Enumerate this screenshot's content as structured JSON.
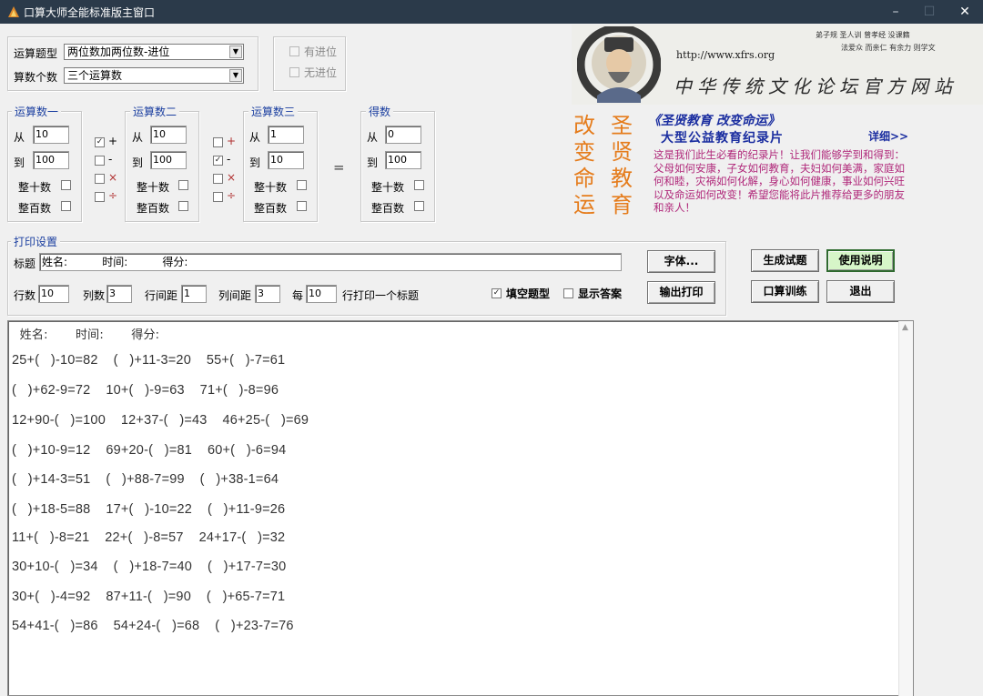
{
  "window": {
    "title": "口算大师全能标准版主窗口",
    "min": "–",
    "max": "☐",
    "close": "✕"
  },
  "settings": {
    "type_label": "运算题型",
    "type_value": "两位数加两位数-进位",
    "count_label": "算数个数",
    "count_value": "三个运算数",
    "carry": "有进位",
    "nocarry": "无进位"
  },
  "operands": {
    "from": "从",
    "to": "到",
    "tens": "整十数",
    "hundreds": "整百数",
    "op1": {
      "title": "运算数一",
      "from": "10",
      "to": "100"
    },
    "op2": {
      "title": "运算数二",
      "from": "10",
      "to": "100"
    },
    "op3": {
      "title": "运算数三",
      "from": "1",
      "to": "10"
    },
    "result": {
      "title": "得数",
      "from": "0",
      "to": "100"
    },
    "ops": [
      "+",
      "-",
      "×",
      "÷"
    ],
    "equals": "="
  },
  "banner": {
    "url": "http://www.xfrs.org",
    "title": "中华传统文化论坛官方网站",
    "top_books": "弟子规 圣人训 曾孝经 没课籍",
    "sub_books": "法爱众 而亲仁 有余力 则学文"
  },
  "ad": {
    "left_col": "改变命运",
    "right_col": "圣贤教育",
    "headline": "《圣贤教育 改变命运》",
    "subline": "大型公益教育纪录片",
    "detail": "详细>>",
    "body": "这是我们此生必看的纪录片！让我们能够学到和得到：父母如何安康，子女如何教育，夫妇如何美满，家庭如何和睦，灾祸如何化解，身心如何健康，事业如何兴旺以及命运如何改变！希望您能将此片推荐给更多的朋友和亲人！"
  },
  "print": {
    "group": "打印设置",
    "title_label": "标题",
    "title_value": "姓名:          时间:          得分:",
    "rows_label": "行数",
    "rows": "10",
    "cols_label": "列数",
    "cols": "3",
    "rowgap_label": "行间距",
    "rowgap": "1",
    "colgap_label": "列间距",
    "colgap": "3",
    "every_label": "每",
    "every": "10",
    "every_suffix": "行打印一个标题",
    "fill_blank": "填空题型",
    "show_answer": "显示答案",
    "font_btn": "字体...",
    "print_btn": "输出打印"
  },
  "actions": {
    "generate": "生成试题",
    "help": "使用说明",
    "practice": "口算训练",
    "exit": "退出"
  },
  "output": {
    "header": "  姓名:       时间:       得分:",
    "rows": [
      "25+(   )-10=82    (   )+11-3=20    55+(   )-7=61",
      "(   )+62-9=72    10+(   )-9=63    71+(   )-8=96",
      "12+90-(   )=100    12+37-(   )=43    46+25-(   )=69",
      "(   )+10-9=12    69+20-(   )=81    60+(   )-6=94",
      "(   )+14-3=51    (   )+88-7=99    (   )+38-1=64",
      "(   )+18-5=88    17+(   )-10=22    (   )+11-9=26",
      "11+(   )-8=21    22+(   )-8=57    24+17-(   )=32",
      "30+10-(   )=34    (   )+18-7=40    (   )+17-7=30",
      "30+(   )-4=92    87+11-(   )=90    (   )+65-7=71",
      "54+41-(   )=86    54+24-(   )=68    (   )+23-7=76"
    ]
  }
}
